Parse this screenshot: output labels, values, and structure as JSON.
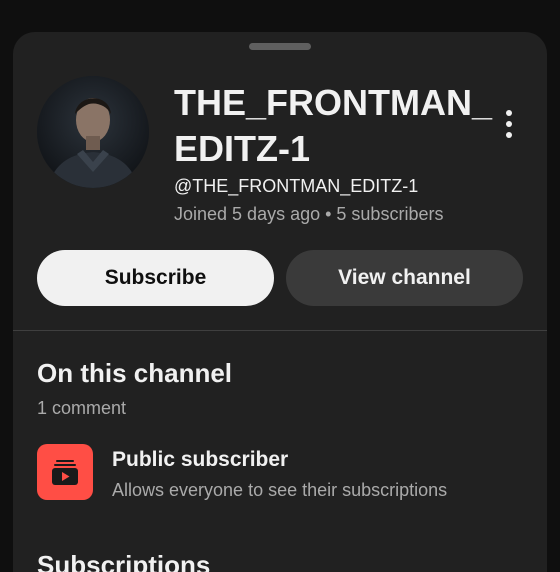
{
  "channel": {
    "title": "THE_FRONTMAN_EDITZ-1",
    "handle": "@THE_FRONTMAN_EDITZ-1",
    "meta": "Joined 5 days ago • 5 subscribers"
  },
  "actions": {
    "subscribe_label": "Subscribe",
    "view_channel_label": "View channel"
  },
  "section": {
    "title": "On this channel",
    "comment_count": "1 comment"
  },
  "public_subscriber": {
    "title": "Public subscriber",
    "description": "Allows everyone to see their subscriptions",
    "icon": "subscriptions-icon",
    "icon_color": "#ff4e45"
  },
  "next_section": {
    "title": "Subscriptions"
  },
  "colors": {
    "background": "#0f0f0f",
    "sheet": "#212121",
    "primary_button": "#f1f1f1",
    "secondary_button": "#3a3a3a",
    "secondary_text": "#aaaaaa"
  }
}
